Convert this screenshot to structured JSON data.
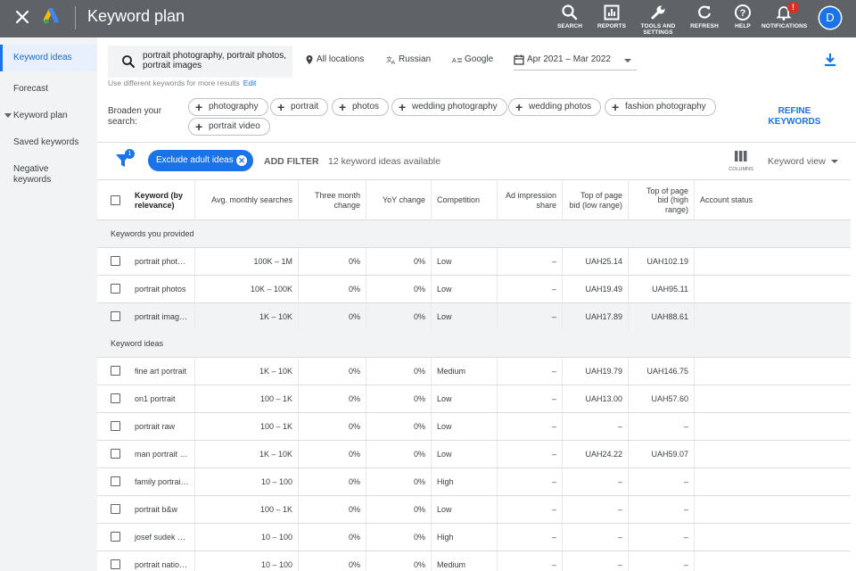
{
  "app": {
    "title": "Keyword plan",
    "avatar_initial": "D",
    "notifications_badge": "!"
  },
  "toolbar_buttons": [
    {
      "label": "SEARCH",
      "icon": "search-icon"
    },
    {
      "label": "REPORTS",
      "icon": "reports-icon"
    },
    {
      "label": "TOOLS AND SETTINGS",
      "icon": "wrench-icon"
    },
    {
      "label": "REFRESH",
      "icon": "refresh-icon"
    },
    {
      "label": "HELP",
      "icon": "help-icon"
    },
    {
      "label": "NOTIFICATIONS",
      "icon": "bell-icon"
    }
  ],
  "sidebar": {
    "items": [
      {
        "label": "Keyword ideas",
        "active": true
      },
      {
        "label": "Forecast"
      },
      {
        "label": "Keyword plan",
        "expandable": true
      },
      {
        "label": "Saved keywords"
      },
      {
        "label": "Negative keywords"
      }
    ]
  },
  "search": {
    "keywords": "portrait photography, portrait photos, portrait images",
    "hint": "Use different keywords for more results",
    "edit_label": "Edit"
  },
  "filters": {
    "location": "All locations",
    "language": "Russian",
    "network": "Google",
    "date_range": "Apr 2021 – Mar 2022"
  },
  "broaden": {
    "label": "Broaden your search:",
    "chips": [
      "photography",
      "portrait",
      "photos",
      "wedding photography",
      "wedding photos",
      "fashion photography",
      "portrait video"
    ],
    "refine_label": "REFINE KEYWORDS"
  },
  "table_toolbar": {
    "filter_count": "1",
    "exclude_chip": "Exclude adult ideas",
    "add_filter": "ADD FILTER",
    "count_text": "12 keyword ideas available",
    "columns_label": "COLUMNS",
    "view_label": "Keyword view"
  },
  "table": {
    "columns": [
      "Keyword (by relevance)",
      "Avg. monthly searches",
      "Three month change",
      "YoY change",
      "Competition",
      "Ad impression share",
      "Top of page bid (low range)",
      "Top of page bid (high range)",
      "Account status"
    ],
    "groups": [
      {
        "label": "Keywords you provided",
        "rows": [
          {
            "keyword": "portrait photo…",
            "searches": "100K – 1M",
            "three_month": "0%",
            "yoy": "0%",
            "competition": "Low",
            "impression": "–",
            "bid_low": "UAH25.14",
            "bid_high": "UAH102.19"
          },
          {
            "keyword": "portrait photos",
            "searches": "10K – 100K",
            "three_month": "0%",
            "yoy": "0%",
            "competition": "Low",
            "impression": "–",
            "bid_low": "UAH19.49",
            "bid_high": "UAH95.11"
          },
          {
            "keyword": "portrait imag…",
            "searches": "1K – 10K",
            "three_month": "0%",
            "yoy": "0%",
            "competition": "Low",
            "impression": "–",
            "bid_low": "UAH17.89",
            "bid_high": "UAH88.61",
            "highlight": true
          }
        ]
      },
      {
        "label": "Keyword ideas",
        "rows": [
          {
            "keyword": "fine art portrait",
            "searches": "1K – 10K",
            "three_month": "0%",
            "yoy": "0%",
            "competition": "Medium",
            "impression": "–",
            "bid_low": "UAH19.79",
            "bid_high": "UAH146.75"
          },
          {
            "keyword": "on1 portrait",
            "searches": "100 – 1K",
            "three_month": "0%",
            "yoy": "0%",
            "competition": "Low",
            "impression": "–",
            "bid_low": "UAH13.00",
            "bid_high": "UAH57.60"
          },
          {
            "keyword": "portrait raw",
            "searches": "100 – 1K",
            "three_month": "0%",
            "yoy": "0%",
            "competition": "Low",
            "impression": "–",
            "bid_low": "–",
            "bid_high": "–"
          },
          {
            "keyword": "man portrait …",
            "searches": "1K – 10K",
            "three_month": "0%",
            "yoy": "0%",
            "competition": "Low",
            "impression": "–",
            "bid_low": "UAH24.22",
            "bid_high": "UAH59.07"
          },
          {
            "keyword": "family portrai…",
            "searches": "10 – 100",
            "three_month": "0%",
            "yoy": "0%",
            "competition": "High",
            "impression": "–",
            "bid_low": "–",
            "bid_high": "–"
          },
          {
            "keyword": "portrait b&w",
            "searches": "100 – 1K",
            "three_month": "0%",
            "yoy": "0%",
            "competition": "Low",
            "impression": "–",
            "bid_low": "–",
            "bid_high": "–"
          },
          {
            "keyword": "josef sudek p…",
            "searches": "10 – 100",
            "three_month": "0%",
            "yoy": "0%",
            "competition": "High",
            "impression": "–",
            "bid_low": "–",
            "bid_high": "–"
          },
          {
            "keyword": "portrait natio…",
            "searches": "10 – 100",
            "three_month": "0%",
            "yoy": "0%",
            "competition": "Medium",
            "impression": "–",
            "bid_low": "–",
            "bid_high": "–"
          }
        ]
      }
    ]
  },
  "colors": {
    "topbar": "#5f6368",
    "accent": "#1a73e8",
    "sidebar": "#f1f3f4",
    "alert": "#d93025"
  }
}
